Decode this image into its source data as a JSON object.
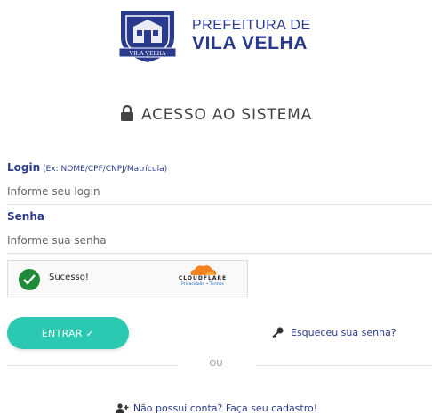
{
  "brand": {
    "line1": "PREFEITURA DE",
    "line2": "VILA VELHA",
    "crest_ribbon": "VILA VELHA",
    "primary_color": "#2a3a8c"
  },
  "page": {
    "title": "ACESSO AO SISTEMA"
  },
  "login": {
    "label": "Login",
    "hint": "(Ex: NOME/CPF/CNPJ/Matrícula)",
    "placeholder": "Informe seu login",
    "value": ""
  },
  "password": {
    "label": "Senha",
    "placeholder": "Informe sua senha",
    "value": ""
  },
  "captcha": {
    "status": "Sucesso!",
    "provider": "CLOUDFLARE",
    "links": "Privacidade • Termos",
    "status_color": "#1f8a38"
  },
  "actions": {
    "enter_label": "ENTRAR ✓",
    "enter_color": "#2bc9b1",
    "forgot_label": "Esqueceu sua senha?",
    "or_label": "OU",
    "signup_label": "Não possui conta? Faça seu cadastro!"
  },
  "icons": [
    "lock-icon",
    "check-icon",
    "cloudflare-logo",
    "key-icon",
    "add-user-icon"
  ]
}
